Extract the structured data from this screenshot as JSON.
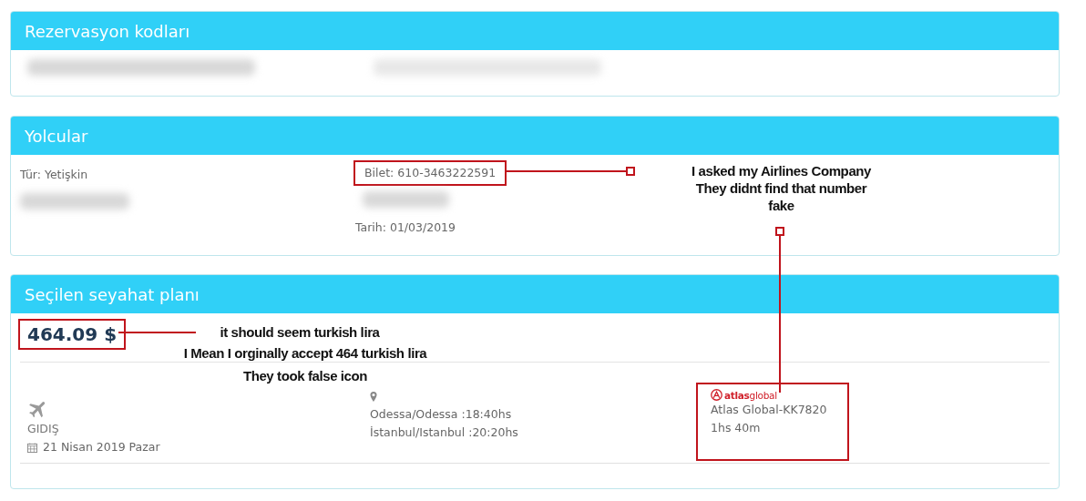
{
  "reservation_codes": {
    "title": "Rezervasyon kodları"
  },
  "passengers": {
    "title": "Yolcular",
    "type": "Tür: Yetişkin",
    "ticket": {
      "text": "Bilet: 610-3463222591",
      "highlighted": true
    },
    "date": "Tarih: 01/03/2019"
  },
  "itinerary": {
    "title": "Seçilen seyahat planı",
    "price": {
      "text": "464.09 $",
      "highlighted": true
    },
    "direction": "GIDIŞ",
    "departure_date": "21 Nisan 2019 Pazar",
    "stops": [
      "Odessa/Odessa :18:40hs",
      "İstanbul/Istanbul :20:20hs"
    ],
    "airline": {
      "logo": "**atlas**global",
      "flight": "Atlas Global-KK7820",
      "duration": "1hs 40m",
      "highlighted": true
    }
  },
  "annotations": [
    {
      "text": "I asked my Airlines Company\nThey didnt find that number\nfake"
    },
    {
      "text": "it should seem turkish lira"
    },
    {
      "text": "I Mean I orginally accept 464 turkish lira\nThey took false icon"
    }
  ]
}
